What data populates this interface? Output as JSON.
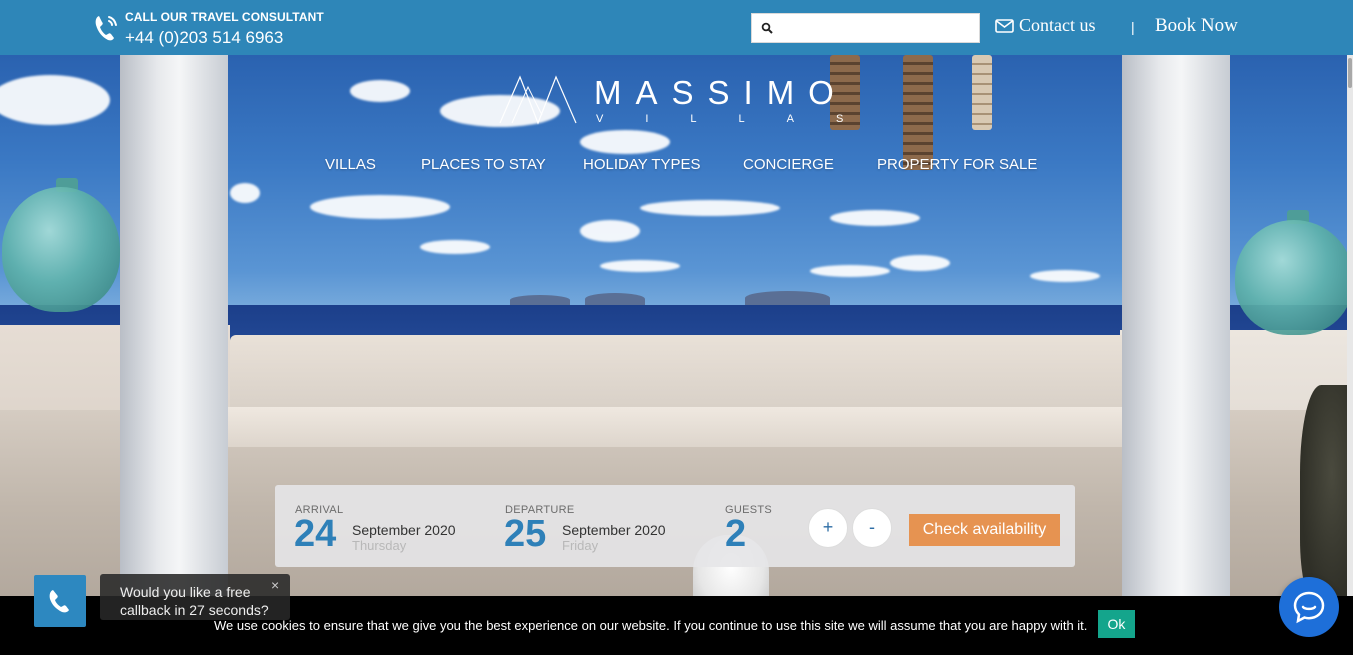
{
  "topbar": {
    "call_label": "CALL OUR TRAVEL CONSULTANT",
    "phone_number": "+44 (0)203 514 6963",
    "search_placeholder": "",
    "contact_label": "Contact us",
    "divider": "|",
    "book_label": "Book Now"
  },
  "logo": {
    "name": "MASSIMO",
    "sub": "VILLAS"
  },
  "nav": {
    "items": [
      {
        "label": "VILLAS"
      },
      {
        "label": "PLACES TO STAY"
      },
      {
        "label": "HOLIDAY TYPES"
      },
      {
        "label": "CONCIERGE"
      },
      {
        "label": "PROPERTY FOR SALE"
      }
    ]
  },
  "booking": {
    "arrival": {
      "label": "ARRIVAL",
      "day": "24",
      "month": "September 2020",
      "weekday": "Thursday"
    },
    "departure": {
      "label": "DEPARTURE",
      "day": "25",
      "month": "September 2020",
      "weekday": "Friday"
    },
    "guests": {
      "label": "GUESTS",
      "count": "2"
    },
    "plus": "+",
    "minus": "-",
    "check_label": "Check availability"
  },
  "callback": {
    "text": "Would you like a free callback in 27 seconds?",
    "close": "×"
  },
  "cookie": {
    "text": "We use cookies to ensure that we give you the best experience on our website. If you continue to use this site we will assume that you are happy with it.",
    "ok_label": "Ok"
  },
  "colors": {
    "topbar": "#2e86b8",
    "accent_blue": "#2e80b8",
    "cta_orange": "#e69351",
    "cookie_ok": "#14a58c",
    "chat": "#1e6fd9"
  },
  "icons": {
    "phone": "phone-icon",
    "search": "search-icon",
    "mail": "mail-icon",
    "callback": "phone-handset-icon",
    "chat": "chat-bubble-icon"
  }
}
